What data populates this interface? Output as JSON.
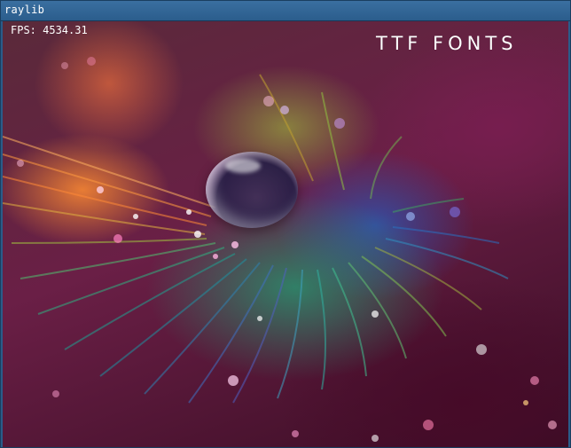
{
  "window": {
    "title": "raylib"
  },
  "overlay": {
    "fps_text": "FPS: 4534.31",
    "font_demo_text": "TTF FONTS"
  },
  "scene": {
    "image_subject": "peacock-feather-with-water-droplet-and-glitter"
  },
  "colors": {
    "titlebar": "#2b5d8c",
    "window_border": "#1a3e60",
    "text": "#ffffff"
  }
}
